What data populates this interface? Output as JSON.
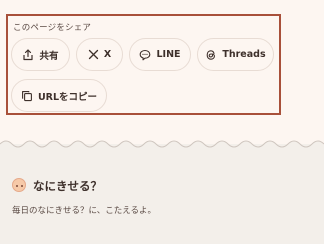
{
  "share": {
    "caption": "このページをシェア",
    "buttons": [
      {
        "id": "share",
        "label": "共有",
        "icon": "share-icon"
      },
      {
        "id": "x",
        "label": "X",
        "icon": "x-icon"
      },
      {
        "id": "line",
        "label": "LINE",
        "icon": "line-icon"
      },
      {
        "id": "threads",
        "label": "Threads",
        "icon": "threads-icon"
      },
      {
        "id": "copy",
        "label": "URLをコピー",
        "icon": "copy-icon"
      }
    ]
  },
  "section": {
    "title": "なにきせる？",
    "description": "毎日のなにきせる？に、こたえるよ。",
    "avatar_icon": "baby-face-icon"
  },
  "colors": {
    "background": "#fdf6f1",
    "highlight_border": "#a8503a",
    "lower_section": "#f3efea"
  }
}
